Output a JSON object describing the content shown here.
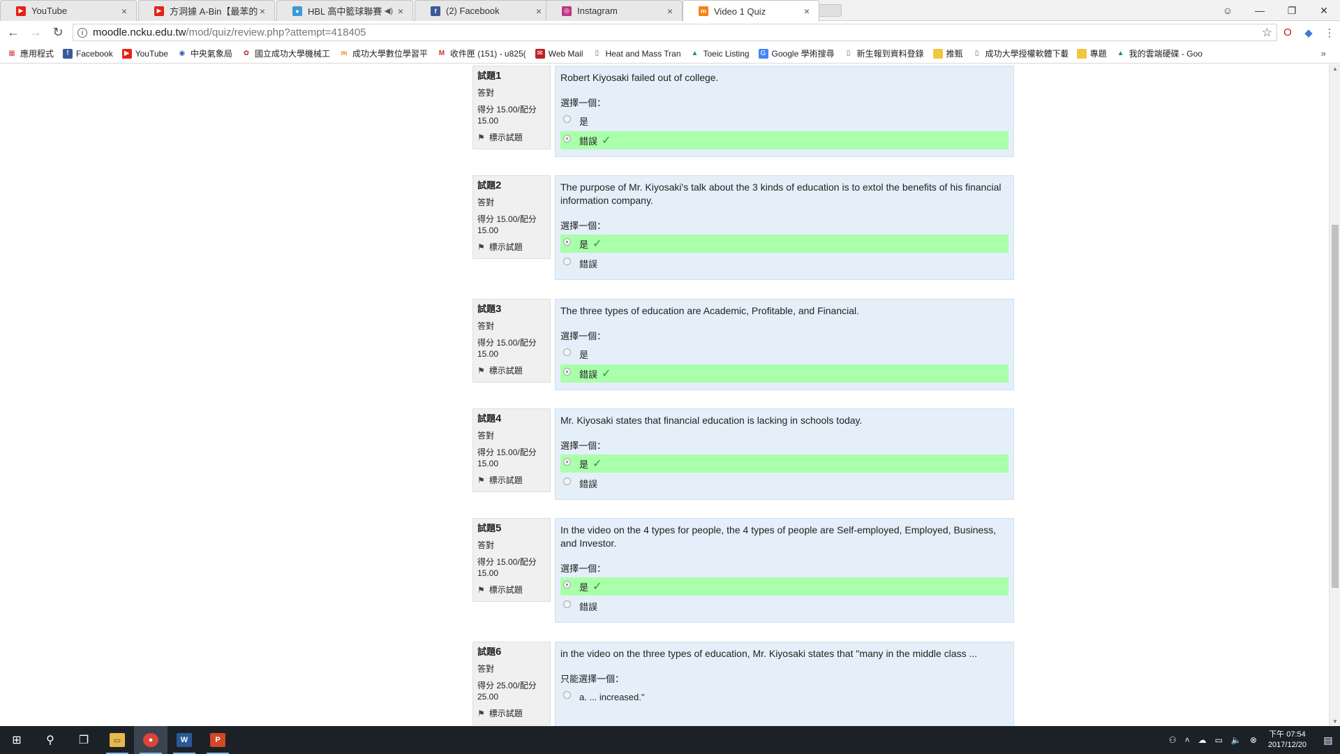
{
  "browser": {
    "tabs": [
      {
        "label": "YouTube",
        "icon": "youtube-icon",
        "color": "#e62117"
      },
      {
        "label": "方洞據 A-Bin【最苯的人",
        "icon": "youtube-icon",
        "color": "#e62117"
      },
      {
        "label": "HBL 高中籃球聯賽 - ",
        "icon": "hbl-icon",
        "color": "#3a9bd5"
      },
      {
        "label": "(2) Facebook",
        "icon": "facebook-icon",
        "color": "#3b5998"
      },
      {
        "label": "Instagram",
        "icon": "instagram-icon",
        "color": "#c13584"
      },
      {
        "label": "Video 1 Quiz",
        "icon": "moodle-icon",
        "color": "#f98012"
      }
    ],
    "url_host": "moodle.ncku.edu.tw",
    "url_path": "/mod/quiz/review.php?attempt=418405",
    "bookmarks": [
      {
        "label": "應用程式",
        "icon": "apps-grid-icon"
      },
      {
        "label": "Facebook",
        "icon": "facebook-icon"
      },
      {
        "label": "YouTube",
        "icon": "youtube-icon"
      },
      {
        "label": "中央氣象局",
        "icon": "cwb-icon"
      },
      {
        "label": "國立成功大學機械工",
        "icon": "ncku-icon"
      },
      {
        "label": "成功大學數位學習平",
        "icon": "moodle-icon"
      },
      {
        "label": "收件匣 (151) - u825(",
        "icon": "gmail-icon"
      },
      {
        "label": "Web Mail",
        "icon": "webmail-icon"
      },
      {
        "label": "Heat and Mass Tran",
        "icon": "page-icon"
      },
      {
        "label": "Toeic Listing",
        "icon": "drive-icon"
      },
      {
        "label": "Google 學術搜尋",
        "icon": "scholar-icon"
      },
      {
        "label": "新生報到資料登錄",
        "icon": "page-icon"
      },
      {
        "label": "推甄",
        "icon": "folder-icon"
      },
      {
        "label": "成功大學授權軟體下載",
        "icon": "page-icon"
      },
      {
        "label": "專題",
        "icon": "folder-icon"
      },
      {
        "label": "我的雲端硬碟 - Goo",
        "icon": "drive-icon"
      }
    ]
  },
  "quiz": {
    "questions": [
      {
        "num_label": "試題",
        "num": "1",
        "state": "答對",
        "grade": "得分 15.00/配分 15.00",
        "flag": "標示試題",
        "text": "Robert Kiyosaki failed out of college.",
        "prompt": "選擇一個：",
        "options": [
          {
            "label": "是",
            "selected": false,
            "correct": false
          },
          {
            "label": "錯誤",
            "selected": true,
            "correct": true
          }
        ]
      },
      {
        "num_label": "試題",
        "num": "2",
        "state": "答對",
        "grade": "得分 15.00/配分 15.00",
        "flag": "標示試題",
        "text": "The purpose of Mr. Kiyosaki's talk about the 3 kinds of education is to extol the benefits of his financial information company.",
        "prompt": "選擇一個：",
        "options": [
          {
            "label": "是",
            "selected": true,
            "correct": true
          },
          {
            "label": "錯誤",
            "selected": false,
            "correct": false
          }
        ]
      },
      {
        "num_label": "試題",
        "num": "3",
        "state": "答對",
        "grade": "得分 15.00/配分 15.00",
        "flag": "標示試題",
        "text": "The three types of education are Academic, Profitable, and Financial.",
        "prompt": "選擇一個：",
        "options": [
          {
            "label": "是",
            "selected": false,
            "correct": false
          },
          {
            "label": "錯誤",
            "selected": true,
            "correct": true
          }
        ]
      },
      {
        "num_label": "試題",
        "num": "4",
        "state": "答對",
        "grade": "得分 15.00/配分 15.00",
        "flag": "標示試題",
        "text": "Mr. Kiyosaki states that financial education is lacking in schools today.",
        "prompt": "選擇一個：",
        "options": [
          {
            "label": "是",
            "selected": true,
            "correct": true
          },
          {
            "label": "錯誤",
            "selected": false,
            "correct": false
          }
        ]
      },
      {
        "num_label": "試題",
        "num": "5",
        "state": "答對",
        "grade": "得分 15.00/配分 15.00",
        "flag": "標示試題",
        "text": "In the video on the 4 types for people, the 4 types of people are Self-employed, Employed, Business, and Investor.",
        "prompt": "選擇一個：",
        "options": [
          {
            "label": "是",
            "selected": true,
            "correct": true
          },
          {
            "label": "錯誤",
            "selected": false,
            "correct": false
          }
        ]
      },
      {
        "num_label": "試題",
        "num": "6",
        "state": "答對",
        "grade": "得分 25.00/配分 25.00",
        "flag": "標示試題",
        "text": "in the video on the three types of education, Mr. Kiyosaki states that \"many in the middle class ...",
        "prompt": "只能選擇一個：",
        "options": [
          {
            "label": "a. ... increased.\"",
            "selected": false,
            "correct": false
          }
        ]
      }
    ]
  },
  "taskbar": {
    "clock_time": "下午 07:54",
    "clock_date": "2017/12/20"
  }
}
